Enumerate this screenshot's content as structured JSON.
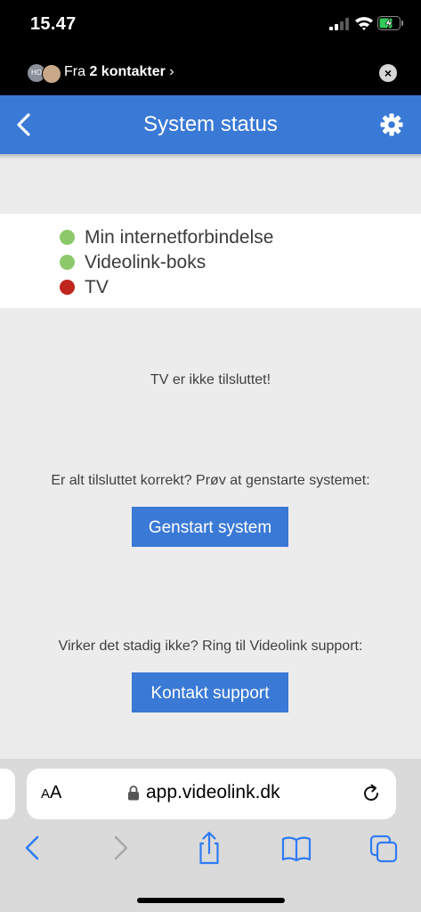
{
  "status_bar": {
    "time": "15.47"
  },
  "notification": {
    "avatar_initials": "HO",
    "prefix": "Fra ",
    "contacts": "2 kontakter",
    "chevron": "›"
  },
  "header": {
    "title": "System status"
  },
  "status_list": [
    {
      "label": "Min internetforbindelse",
      "color": "#8bc96a"
    },
    {
      "label": "Videolink-boks",
      "color": "#8bc96a"
    },
    {
      "label": "TV",
      "color": "#c0261f"
    }
  ],
  "messages": {
    "tv_status": "TV er ikke tilsluttet!",
    "restart_prompt": "Er alt tilsluttet korrekt? Prøv at genstarte systemet:",
    "support_prompt": "Virker det stadig ikke? Ring til Videolink support:"
  },
  "buttons": {
    "restart": "Genstart system",
    "support": "Kontakt support"
  },
  "safari": {
    "aa_small": "A",
    "aa_large": "A",
    "url": "app.videolink.dk"
  },
  "colors": {
    "accent": "#3a79d6",
    "ok": "#8bc96a",
    "error": "#c0261f",
    "toolbar_icon": "#2f7bf5"
  }
}
